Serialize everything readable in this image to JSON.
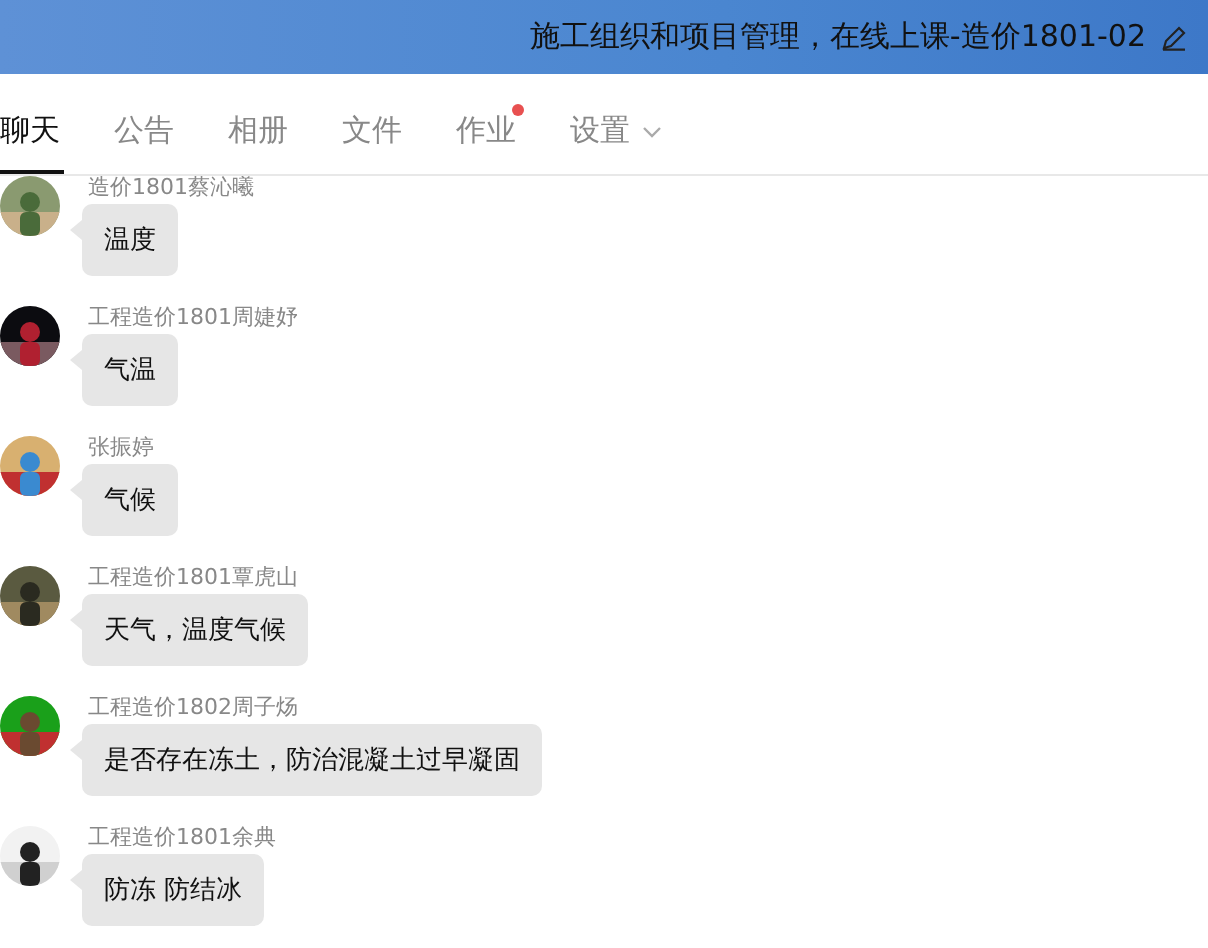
{
  "header": {
    "title": "施工组织和项目管理，在线上课-造价1801-02"
  },
  "tabs": [
    {
      "label": "聊天",
      "selected": true,
      "dot": false,
      "menu": false
    },
    {
      "label": "公告",
      "selected": false,
      "dot": false,
      "menu": false
    },
    {
      "label": "相册",
      "selected": false,
      "dot": false,
      "menu": false
    },
    {
      "label": "文件",
      "selected": false,
      "dot": false,
      "menu": false
    },
    {
      "label": "作业",
      "selected": false,
      "dot": true,
      "menu": false
    },
    {
      "label": "设置",
      "selected": false,
      "dot": false,
      "menu": true
    }
  ],
  "messages": [
    {
      "sender": "造价1801蔡沁曦",
      "text": "温度"
    },
    {
      "sender": "工程造价1801周婕妤",
      "text": "气温"
    },
    {
      "sender": "张振婷",
      "text": "气候"
    },
    {
      "sender": "工程造价1801覃虎山",
      "text": "天气，温度气候"
    },
    {
      "sender": "工程造价1802周子炀",
      "text": "是否存在冻土，防治混凝土过早凝固"
    },
    {
      "sender": "工程造价1801余典",
      "text": "防冻 防结冰"
    }
  ]
}
